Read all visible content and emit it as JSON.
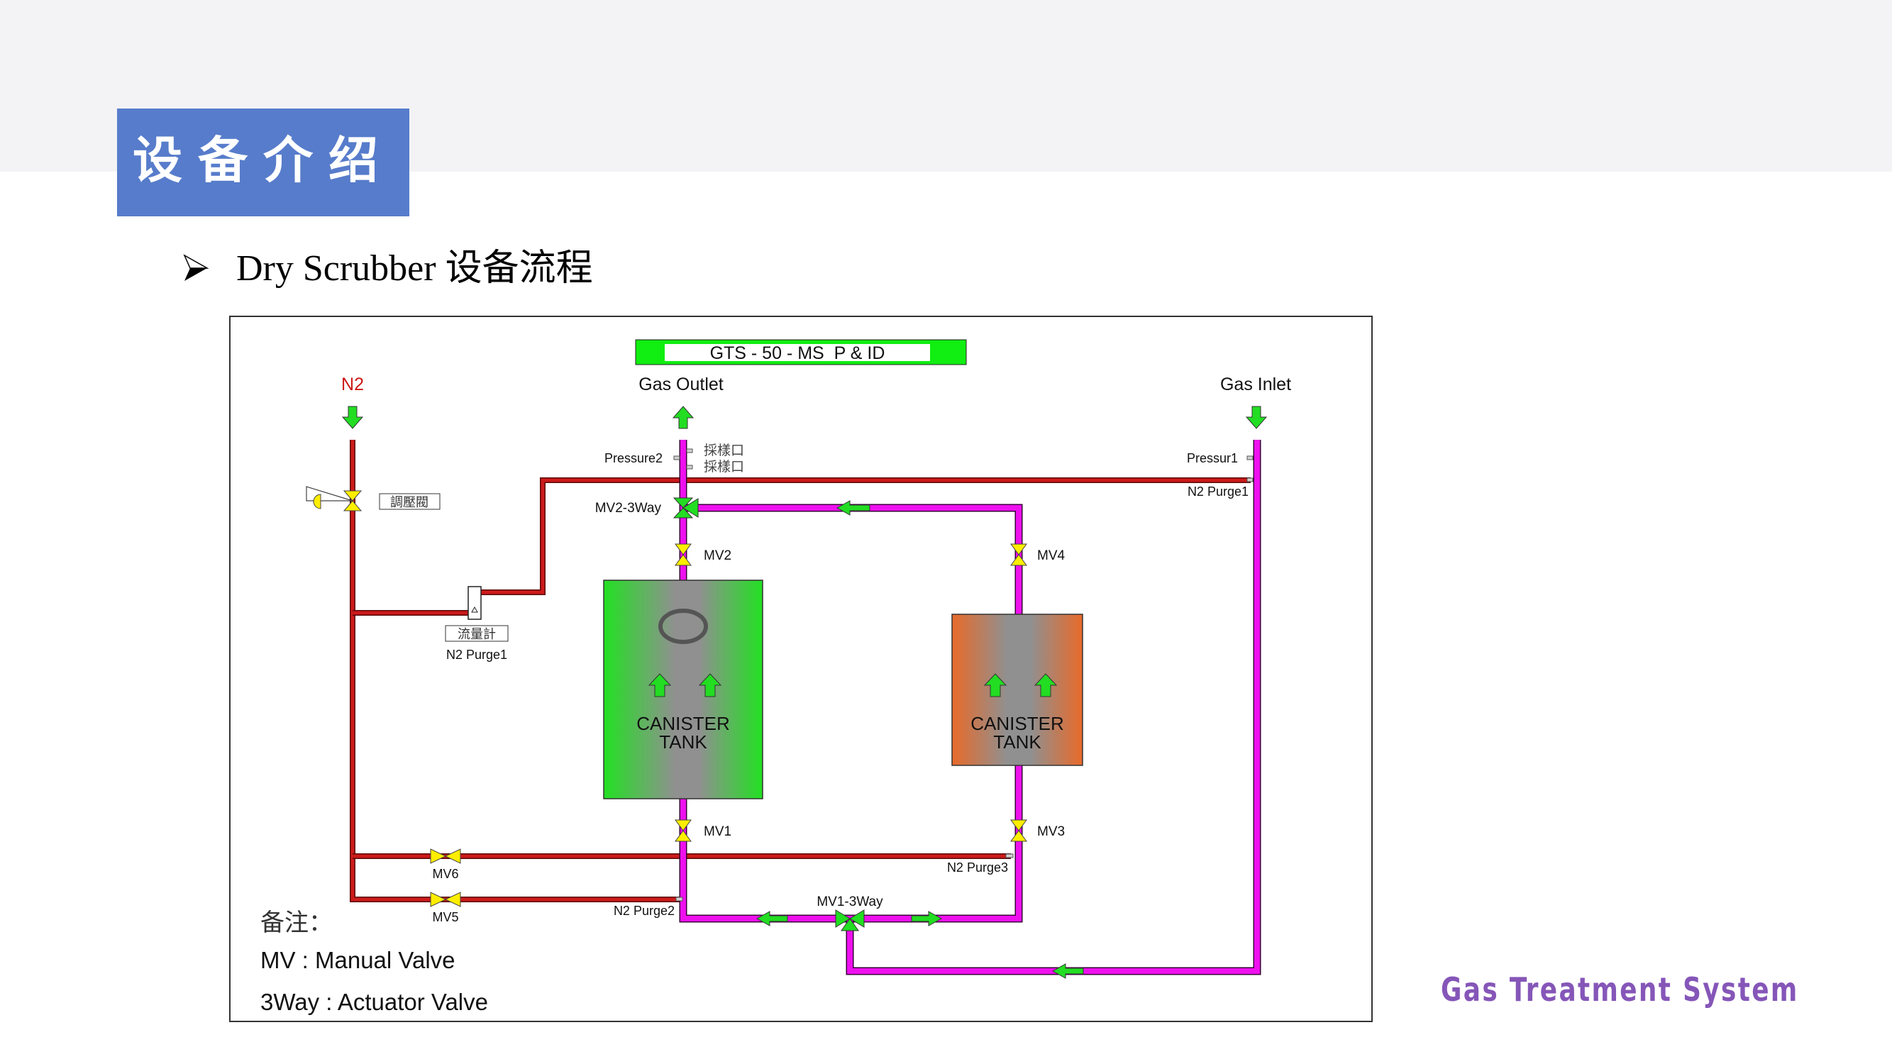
{
  "slide": {
    "section_title": "设备介绍",
    "subtitle": "Dry Scrubber 设备流程",
    "bullet_icon": "arrowhead-bullet",
    "footer_brand": "Gas Treatment System",
    "colors": {
      "title_box": "#577ccb",
      "top_band": "#f3f3f5",
      "footer_brand": "#8556b8"
    }
  },
  "diagram": {
    "title": "GTS - 50 - MS  P & ID",
    "inlets_outlets": {
      "n2": "N2",
      "gas_outlet": "Gas Outlet",
      "gas_inlet": "Gas Inlet"
    },
    "instruments": {
      "pressure2": "Pressure2",
      "pressure1": "Pressur1",
      "sample_port_1": "採樣口",
      "sample_port_2": "採樣口",
      "regulator": "調壓閥",
      "flowmeter": "流量計",
      "flowmeter_label": "N2 Purge1",
      "n2_purge1": "N2 Purge1",
      "n2_purge2": "N2 Purge2",
      "n2_purge3": "N2 Purge3"
    },
    "valves": {
      "mv2_3way": "MV2-3Way",
      "mv1_3way": "MV1-3Way",
      "mv1": "MV1",
      "mv2": "MV2",
      "mv3": "MV3",
      "mv4": "MV4",
      "mv5": "MV5",
      "mv6": "MV6"
    },
    "tanks": {
      "left": {
        "line1": "CANISTER",
        "line2": "TANK",
        "status_color": "#22e022"
      },
      "right": {
        "line1": "CANISTER",
        "line2": "TANK",
        "status_color": "#e86a2a"
      }
    },
    "legend": {
      "heading": "备注：",
      "items": [
        "MV : Manual Valve",
        "3Way : Actuator Valve"
      ]
    },
    "colors": {
      "n2_pipe": "#c81e1e",
      "gas_pipe": "#ee10ee",
      "manual_valve": "#ffee00",
      "actuator_valve": "#22dd22",
      "flow_arrow": "#22dd22",
      "title_bar": "#11ee11"
    }
  }
}
